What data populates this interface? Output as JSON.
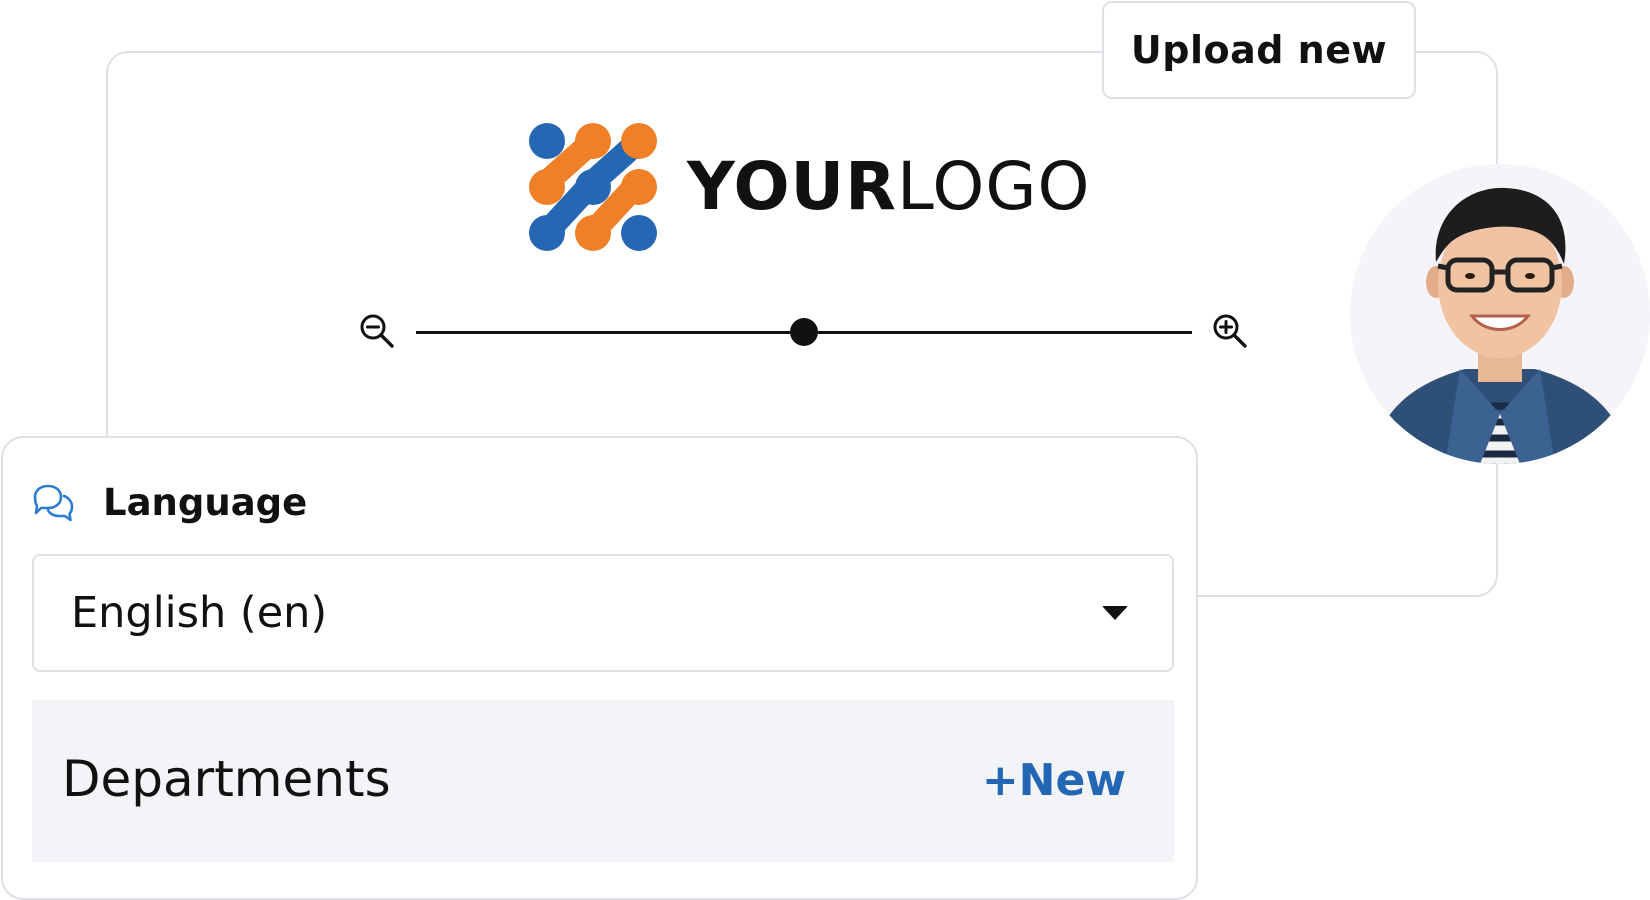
{
  "logo_card": {
    "upload_button_label": "Upload new",
    "logo": {
      "text_bold": "YOUR",
      "text_light": "LOGO",
      "mark_icon": "dots-logo-mark",
      "colors": {
        "blue": "#2667b4",
        "orange": "#f08028"
      }
    },
    "zoom": {
      "zoom_out_icon": "zoom-out-icon",
      "zoom_in_icon": "zoom-in-icon",
      "level": 0.5
    }
  },
  "avatar": {
    "alt": "user profile photo"
  },
  "language_card": {
    "icon": "chat-bubbles-icon",
    "title": "Language",
    "selected_language": "English (en)",
    "departments": {
      "label": "Departments",
      "new_link": "+New",
      "accent_color": "#2366b3"
    }
  }
}
